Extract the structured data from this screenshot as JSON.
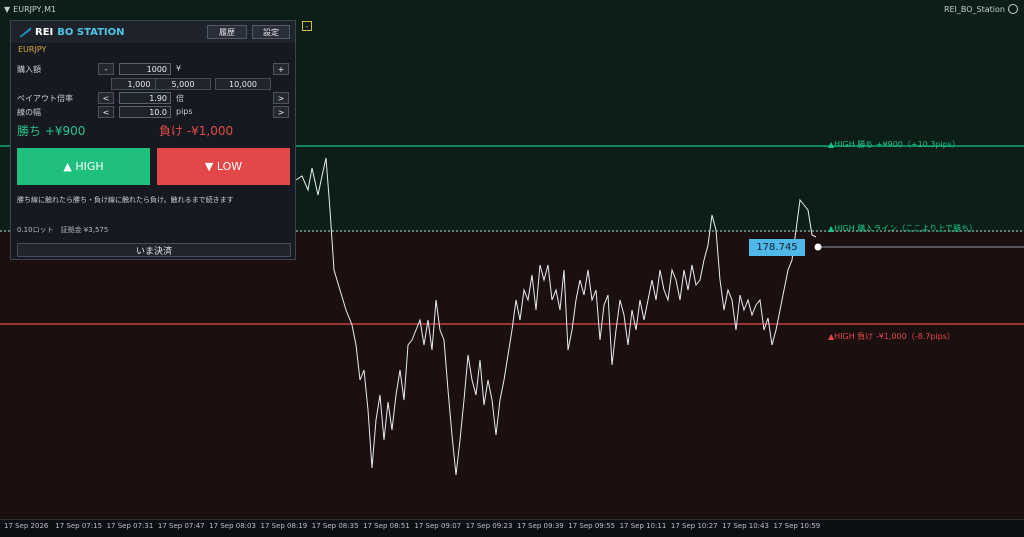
{
  "window": {
    "symbol_tf": "EURJPY,M1",
    "indicator": "REI_BO_Station"
  },
  "panel": {
    "logo_rei": "REI",
    "logo_bo": "BO STATION",
    "history_label": "履歴",
    "settings_label": "設定",
    "symbol": "EURJPY",
    "purchase_label": "購入額",
    "purchase_value": "1000",
    "purchase_unit": "¥",
    "minus": "-",
    "plus": "+",
    "quick_amounts": [
      "1,000",
      "5,000",
      "10,000"
    ],
    "payout_label": "ペイアウト倍率",
    "payout_value": "1.90",
    "payout_unit": "倍",
    "line_width_label": "線の幅",
    "line_width_value": "10.0",
    "line_width_unit": "pips",
    "dec": "<",
    "inc": ">",
    "win_text": "勝ち +¥900",
    "lose_text": "負け -¥1,000",
    "high_button": "▲ HIGH",
    "low_button": "▼ LOW",
    "note": "勝ち線に触れたら勝ち・負け線に触れたら負け。触れるまで続きます",
    "lot": "0.10ロット　証拠金 ¥3,575",
    "settle_button": "いま決済"
  },
  "lines": {
    "win_label": "▲HIGH 勝ち +¥900（+10.3pips）",
    "entry_label": "▲HIGH 購入ライン（ここより上で勝ち）",
    "lose_label": "▲HIGH 負け -¥1,000（-8.7pips）",
    "win_color": "#19c08a",
    "lose_color": "#e24848",
    "entry_color": "#c9ced6"
  },
  "price_tag": "178.745",
  "time_axis": [
    "17 Sep 2026",
    "17 Sep 07:15",
    "17 Sep 07:31",
    "17 Sep 07:47",
    "17 Sep 08:03",
    "17 Sep 08:19",
    "17 Sep 08:35",
    "17 Sep 08:51",
    "17 Sep 09:07",
    "17 Sep 09:23",
    "17 Sep 09:39",
    "17 Sep 09:55",
    "17 Sep 10:11",
    "17 Sep 10:27",
    "17 Sep 10:43",
    "17 Sep 10:59"
  ]
}
